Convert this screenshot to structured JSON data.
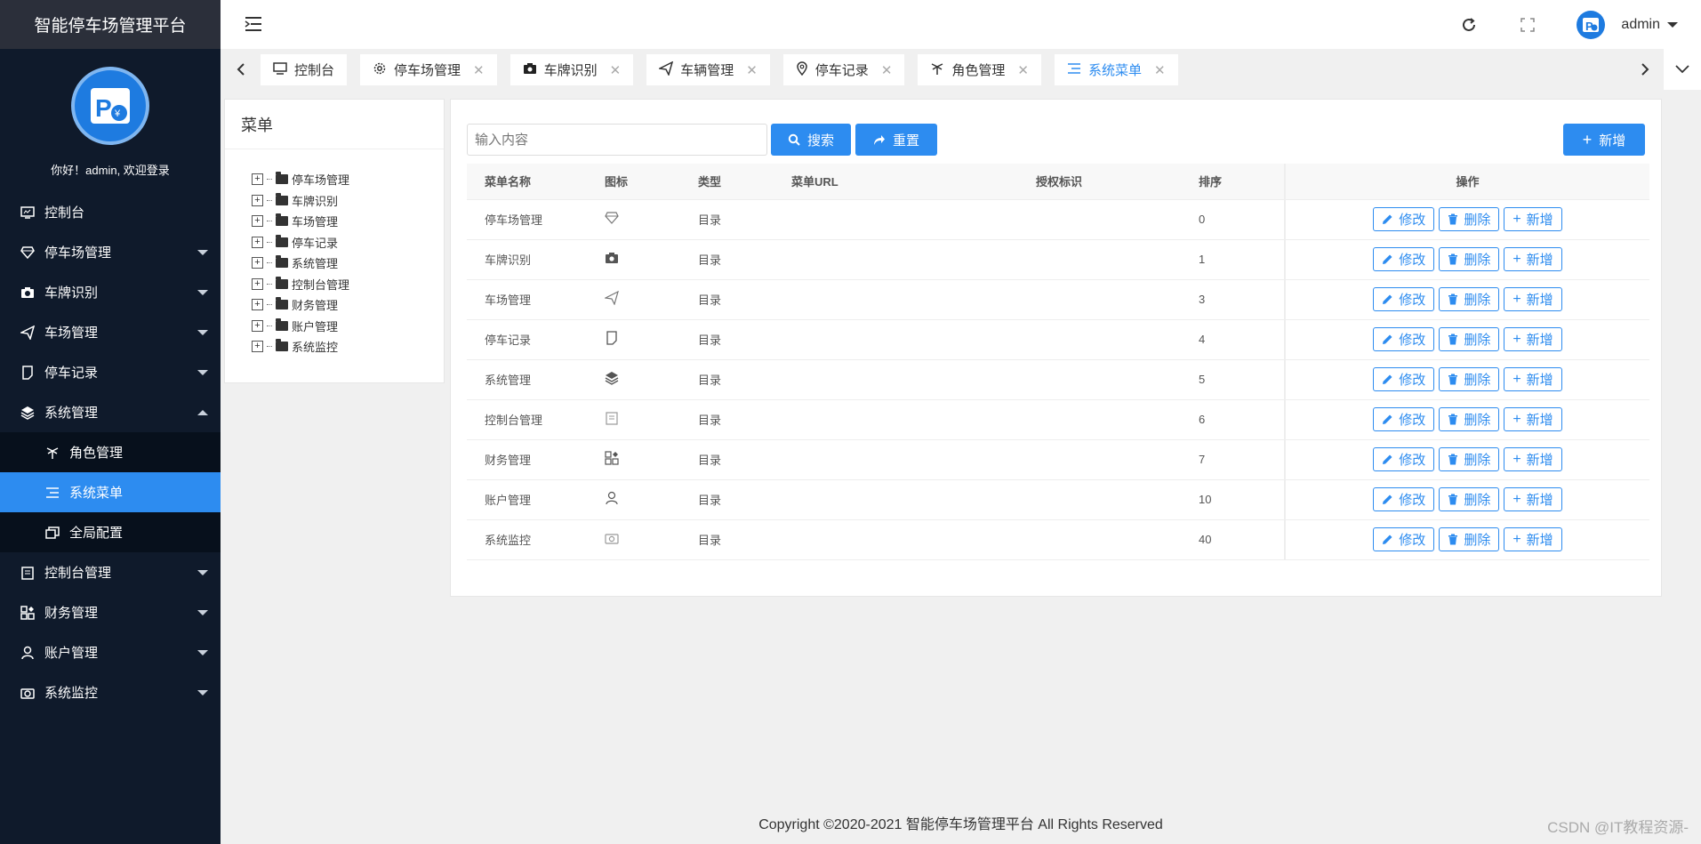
{
  "app": {
    "title": "智能停车场管理平台",
    "welcome": "你好！admin, 欢迎登录"
  },
  "sidebar": {
    "items": [
      {
        "label": "控制台",
        "icon": "monitor-icon"
      },
      {
        "label": "停车场管理",
        "icon": "diamond-icon"
      },
      {
        "label": "车牌识别",
        "icon": "camera-icon"
      },
      {
        "label": "车场管理",
        "icon": "send-icon"
      },
      {
        "label": "停车记录",
        "icon": "note-icon"
      },
      {
        "label": "系统管理",
        "icon": "layers-icon"
      },
      {
        "label": "控制台管理",
        "icon": "clipboard-icon"
      },
      {
        "label": "财务管理",
        "icon": "grid-icon"
      },
      {
        "label": "账户管理",
        "icon": "user-icon"
      },
      {
        "label": "系统监控",
        "icon": "camera-outline-icon"
      }
    ],
    "submenu": [
      {
        "label": "角色管理",
        "icon": "palm-icon"
      },
      {
        "label": "系统菜单",
        "icon": "menu-lines-icon"
      },
      {
        "label": "全局配置",
        "icon": "cards-icon"
      }
    ]
  },
  "header": {
    "username": "admin"
  },
  "tabs": [
    {
      "label": "控制台"
    },
    {
      "label": "停车场管理"
    },
    {
      "label": "车牌识别"
    },
    {
      "label": "车辆管理"
    },
    {
      "label": "停车记录"
    },
    {
      "label": "角色管理"
    },
    {
      "label": "系统菜单"
    }
  ],
  "tree": {
    "title": "菜单",
    "nodes": [
      "停车场管理",
      "车牌识别",
      "车场管理",
      "停车记录",
      "系统管理",
      "控制台管理",
      "财务管理",
      "账户管理",
      "系统监控"
    ]
  },
  "toolbar": {
    "search_placeholder": "输入内容",
    "search_label": "搜索",
    "reset_label": "重置",
    "add_label": "新增"
  },
  "table": {
    "headers": [
      "菜单名称",
      "图标",
      "类型",
      "菜单URL",
      "授权标识",
      "排序",
      "操作"
    ],
    "rows": [
      {
        "name": "停车场管理",
        "icon": "diamond-icon",
        "type": "目录",
        "url": "",
        "perm": "",
        "order": "0"
      },
      {
        "name": "车牌识别",
        "icon": "camera-icon",
        "type": "目录",
        "url": "",
        "perm": "",
        "order": "1"
      },
      {
        "name": "车场管理",
        "icon": "send-icon",
        "type": "目录",
        "url": "",
        "perm": "",
        "order": "3"
      },
      {
        "name": "停车记录",
        "icon": "note-icon",
        "type": "目录",
        "url": "",
        "perm": "",
        "order": "4"
      },
      {
        "name": "系统管理",
        "icon": "layers-icon",
        "type": "目录",
        "url": "",
        "perm": "",
        "order": "5"
      },
      {
        "name": "控制台管理",
        "icon": "clipboard-icon",
        "type": "目录",
        "url": "",
        "perm": "",
        "order": "6"
      },
      {
        "name": "财务管理",
        "icon": "grid-icon",
        "type": "目录",
        "url": "",
        "perm": "",
        "order": "7"
      },
      {
        "name": "账户管理",
        "icon": "user-icon",
        "type": "目录",
        "url": "",
        "perm": "",
        "order": "10"
      },
      {
        "name": "系统监控",
        "icon": "camera-outline-icon",
        "type": "目录",
        "url": "",
        "perm": "",
        "order": "40"
      }
    ],
    "op_edit": "修改",
    "op_delete": "删除",
    "op_add": "新增"
  },
  "footer": {
    "copyright": "Copyright ©2020-2021 智能停车场管理平台 All Rights Reserved"
  },
  "watermark": "CSDN @IT教程资源-",
  "colors": {
    "accent": "#2d8cf0",
    "sidebar": "#0f1a2b"
  }
}
